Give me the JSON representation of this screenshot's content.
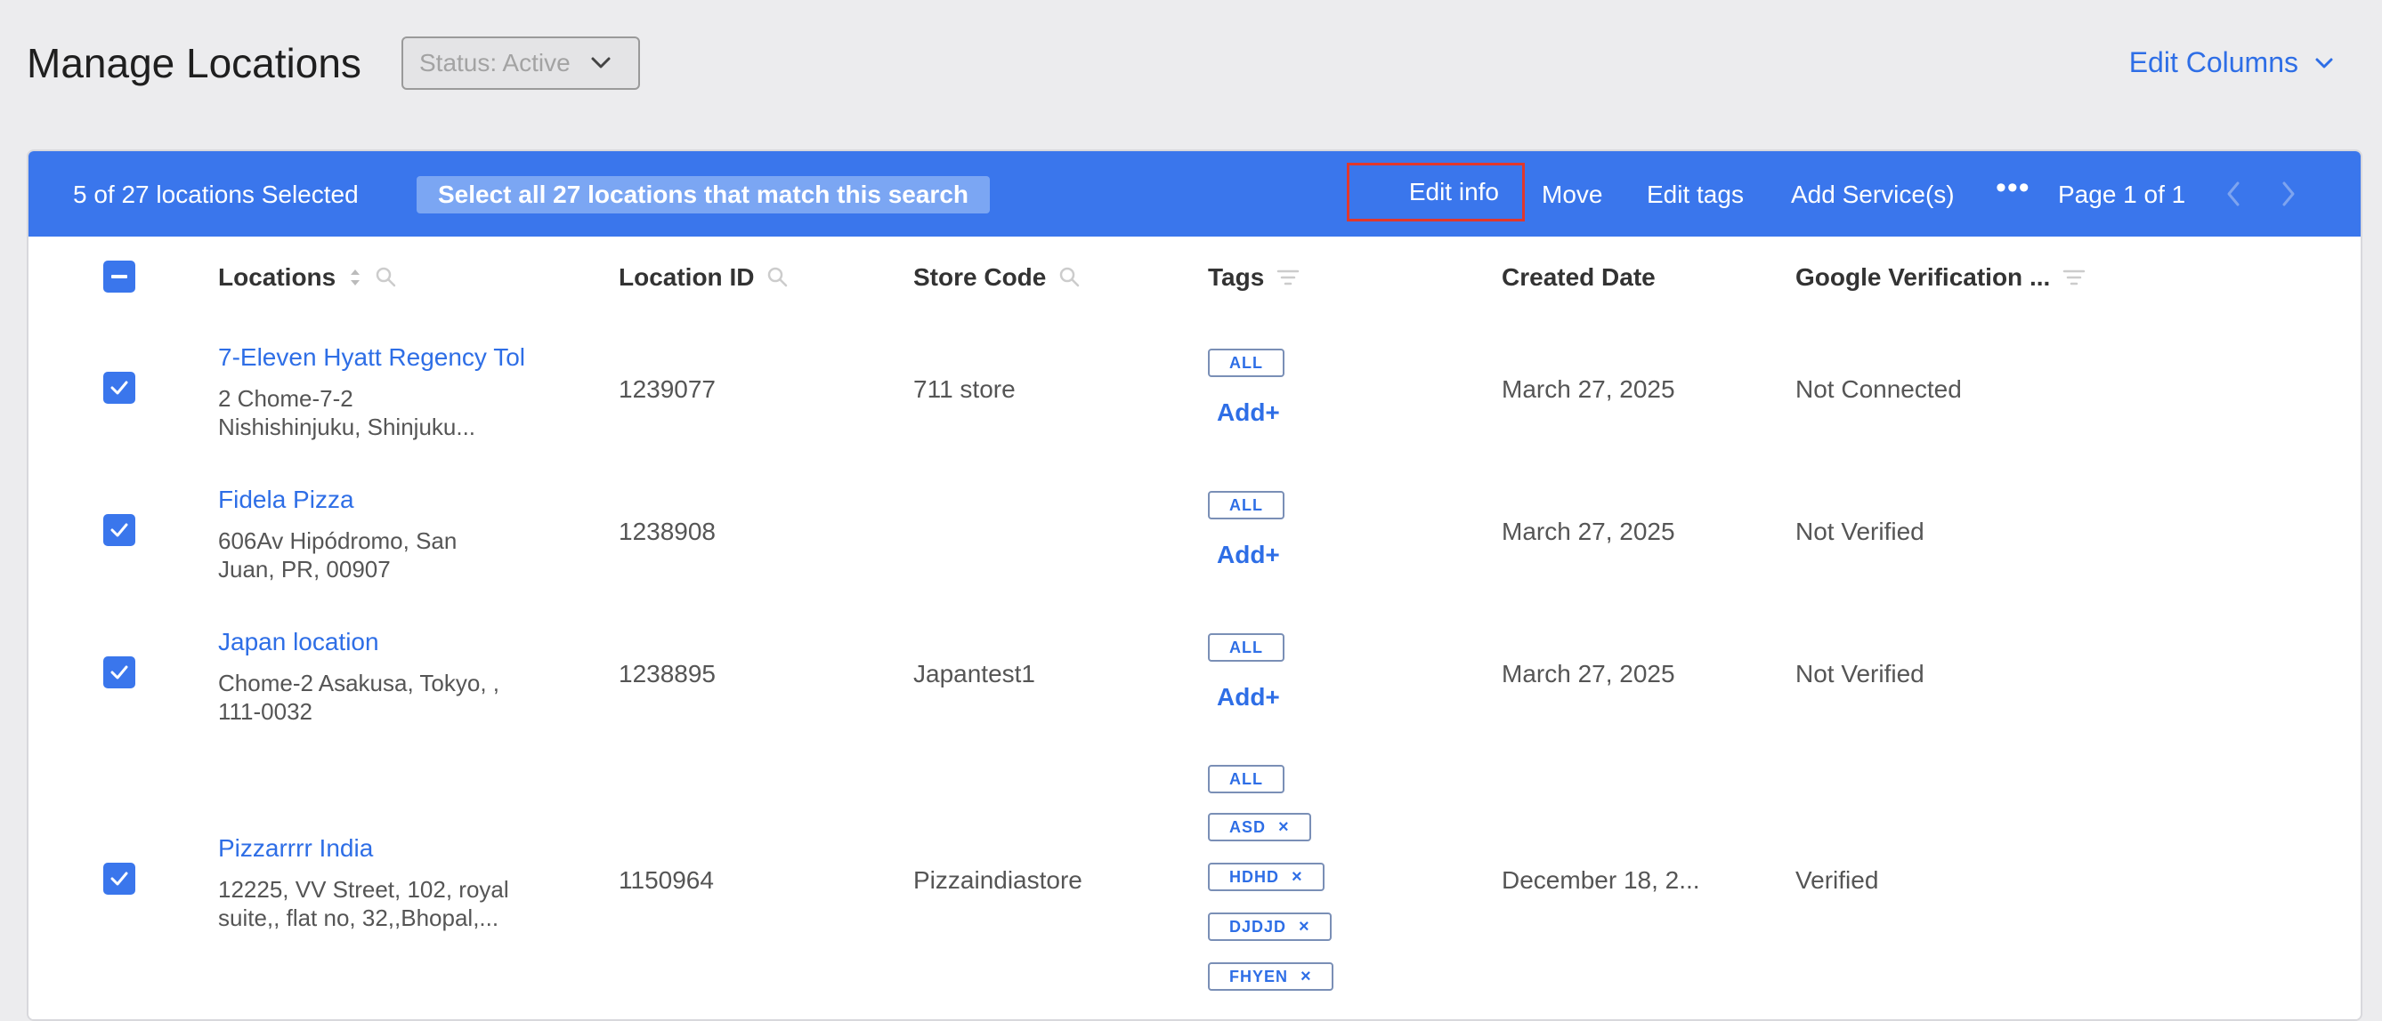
{
  "header": {
    "title": "Manage Locations",
    "status_filter": "Status: Active",
    "edit_columns": "Edit Columns"
  },
  "bulkbar": {
    "selected_count": "5 of 27 locations Selected",
    "select_all": "Select all 27 locations that match this search",
    "edit_info": "Edit info",
    "move": "Move",
    "edit_tags": "Edit tags",
    "add_services": "Add Service(s)",
    "more": "•••",
    "page": "Page 1 of 1"
  },
  "columns": {
    "locations": "Locations",
    "location_id": "Location ID",
    "store_code": "Store Code",
    "tags": "Tags",
    "created_date": "Created Date",
    "google_verification": "Google Verification ..."
  },
  "rows": [
    {
      "name": "7-Eleven Hyatt Regency Tol",
      "addr1": "2 Chome-7-2",
      "addr2": "Nishishinjuku, Shinjuku...",
      "id": "1239077",
      "store_code": "711 store",
      "tags": [
        "ALL"
      ],
      "add_tag": "Add+",
      "created": "March 27, 2025",
      "verification": "Not Connected"
    },
    {
      "name": "Fidela Pizza",
      "addr1": "606Av Hipódromo, San",
      "addr2": "Juan, PR, 00907",
      "id": "1238908",
      "store_code": "",
      "tags": [
        "ALL"
      ],
      "add_tag": "Add+",
      "created": "March 27, 2025",
      "verification": "Not Verified"
    },
    {
      "name": "Japan location",
      "addr1": "Chome-2 Asakusa, Tokyo, ,",
      "addr2": "111-0032",
      "id": "1238895",
      "store_code": "Japantest1",
      "tags": [
        "ALL"
      ],
      "add_tag": "Add+",
      "created": "March 27, 2025",
      "verification": "Not Verified"
    },
    {
      "name": "Pizzarrrr India",
      "addr1": "12225, VV Street, 102, royal",
      "addr2": "suite,, flat no, 32,,Bhopal,...",
      "id": "1150964",
      "store_code": "Pizzaindiastore",
      "tags": [
        "ALL",
        "ASD",
        "HDHD",
        "DJDJD",
        "FHYEN"
      ],
      "tag_remove": "×",
      "created": "December 18, 2...",
      "verification": "Verified"
    }
  ],
  "colors": {
    "accent": "#3a76ec",
    "link": "#2e6ee6",
    "highlight": "#e0372c"
  }
}
